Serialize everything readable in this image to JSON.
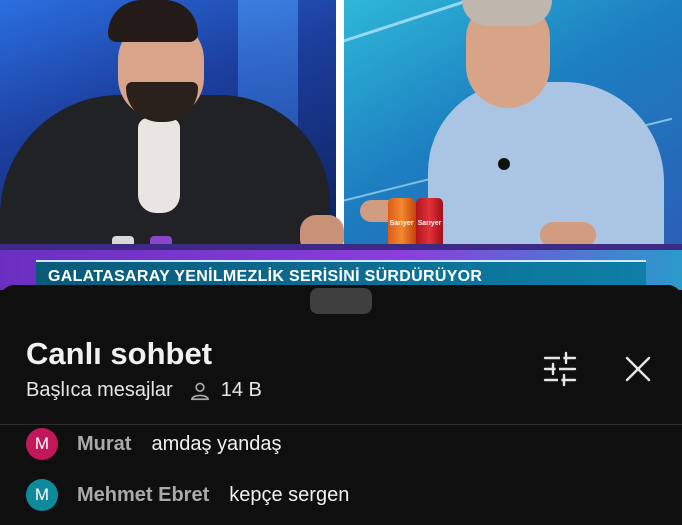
{
  "video": {
    "ticker_text": "GALATASARAY YENİLMEZLİK SERİSİNİ SÜRDÜRÜYOR",
    "can_brand": "Sarıyer"
  },
  "chat": {
    "title": "Canlı sohbet",
    "mode": "Başlıca mesajlar",
    "viewer_icon": "person-icon",
    "viewer_count": "14 B",
    "filter_icon": "filter-sliders-icon",
    "close_icon": "close-icon",
    "messages": [
      {
        "avatar_letter": "M",
        "avatar_color": "#c2185b",
        "author": "Murat",
        "text": "amdaş yandaş"
      },
      {
        "avatar_letter": "M",
        "avatar_color": "#0f8a9a",
        "author": "Mehmet Ebret",
        "text": "kepçe sergen"
      }
    ]
  },
  "colors": {
    "background": "#0f0f0f",
    "title_text": "#f1f1f1",
    "author_text": "#aaaaaa"
  }
}
